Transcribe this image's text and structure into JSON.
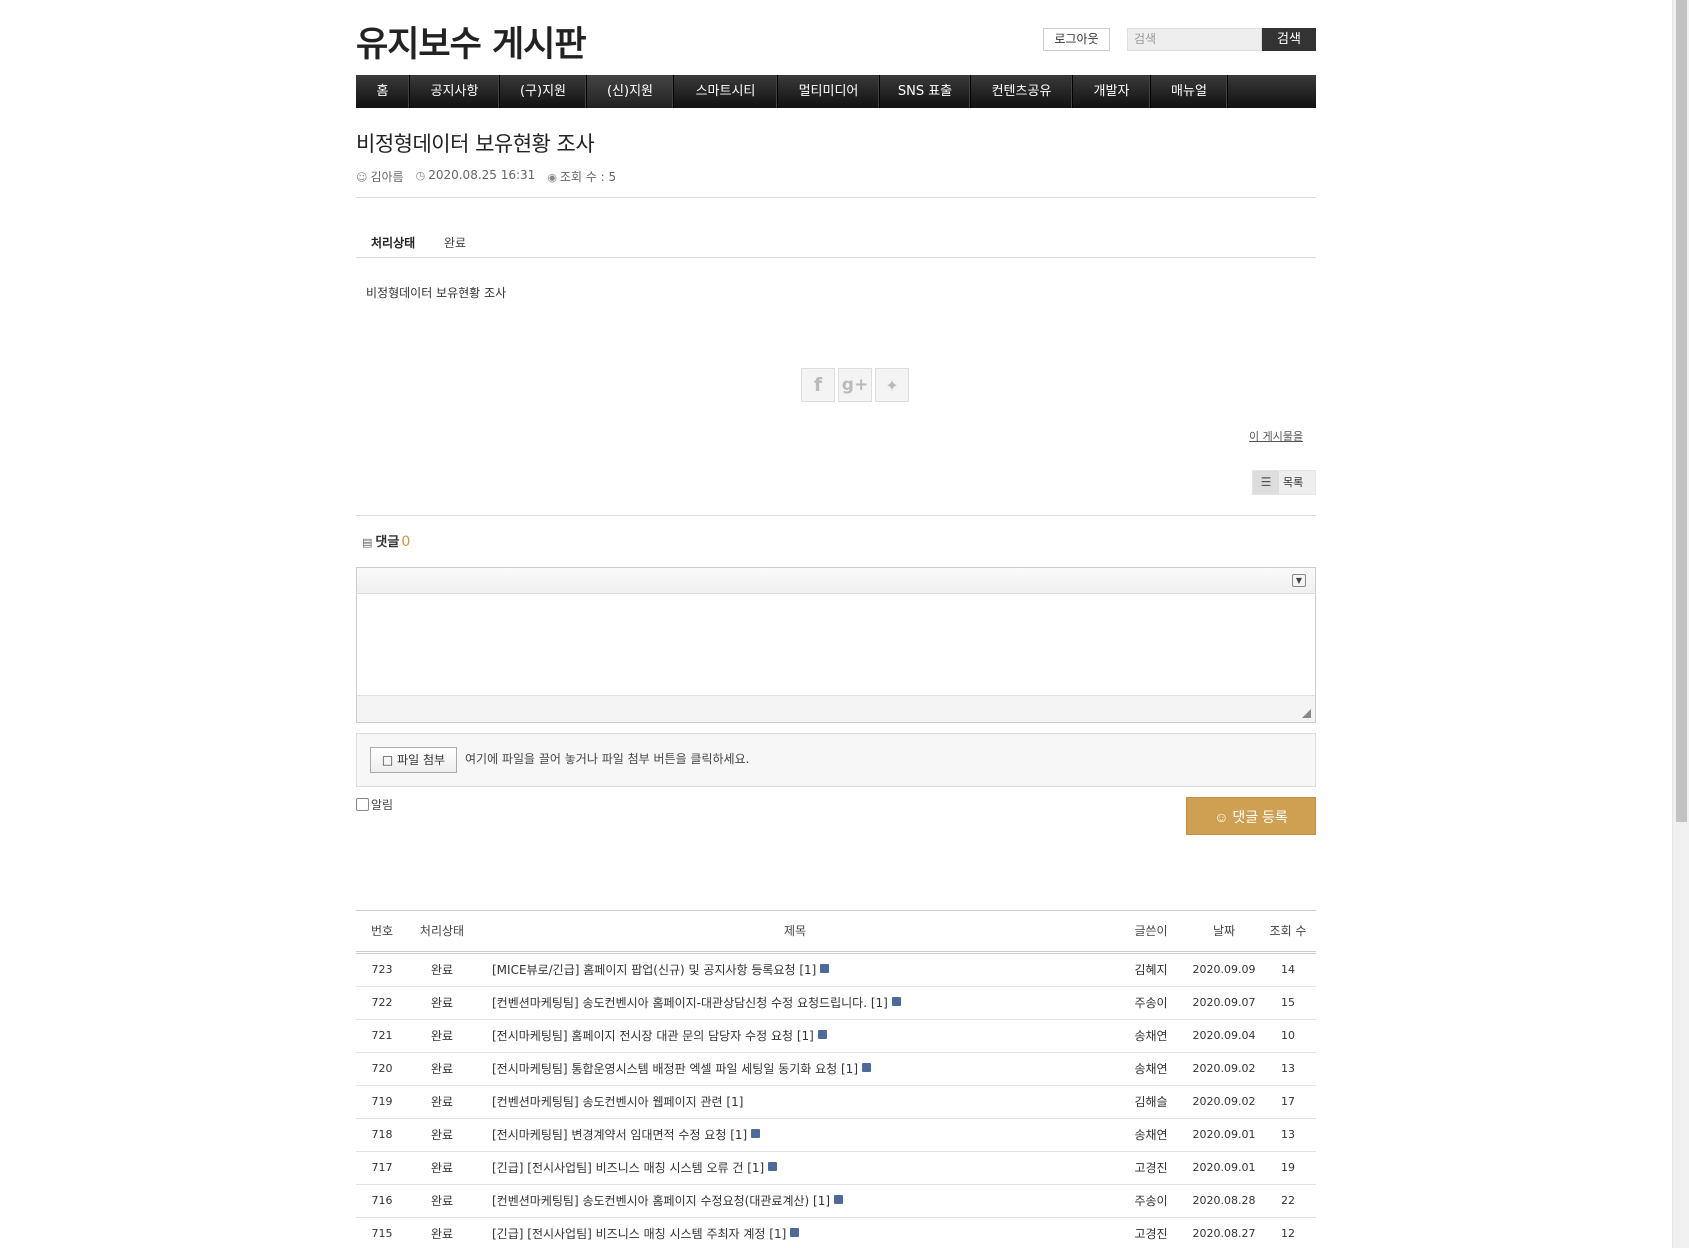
{
  "header": {
    "site_title": "유지보수 게시판",
    "logout_label": "로그아웃",
    "search_placeholder": "검색",
    "search_label": "검색"
  },
  "nav": {
    "items": [
      {
        "label": "홈",
        "active": false
      },
      {
        "label": "공지사항",
        "active": false
      },
      {
        "label": "(구)지원",
        "active": false
      },
      {
        "label": "(신)지원",
        "active": true
      },
      {
        "label": "스마트시티",
        "active": false
      },
      {
        "label": "멀티미디어",
        "active": false
      },
      {
        "label": "SNS 표출",
        "active": false
      },
      {
        "label": "컨텐츠공유",
        "active": false
      },
      {
        "label": "개발자",
        "active": false
      },
      {
        "label": "매뉴얼",
        "active": false
      }
    ]
  },
  "article": {
    "title": "비정형데이터 보유현황 조사",
    "author": "김아름",
    "datetime": "2020.08.25 16:31",
    "views": "조회 수 : 5",
    "status_label": "처리상태",
    "status_value": "완료",
    "body": "비정형데이터 보유현황 조사",
    "share_icons": [
      "facebook-icon",
      "google-plus-icon",
      "twitter-icon"
    ],
    "report_link": "이 게시물을",
    "list_button": "목록"
  },
  "comments": {
    "heading": "댓글",
    "count": "0",
    "upload_button": "파일 첨부",
    "upload_hint": "여기에 파일을 끌어 놓거나 파일 첨부 버튼을 클릭하세요.",
    "notify_label": "알림",
    "submit_label": "댓글 등록",
    "accent_color": "#cfa052"
  },
  "board": {
    "columns": {
      "no": "번호",
      "status": "처리상태",
      "title": "제목",
      "author": "글쓴이",
      "date": "날짜",
      "views": "조회 수"
    },
    "rows": [
      {
        "no": "723",
        "status": "완료",
        "title": "[MICE뷰로/긴급] 홈페이지 팝업(신규) 및 공지사항 등록요청 [1]",
        "file": true,
        "author": "김혜지",
        "date": "2020.09.09",
        "views": "14"
      },
      {
        "no": "722",
        "status": "완료",
        "title": "[컨벤션마케팅팀] 송도컨벤시아 홈페이지-대관상담신청 수정 요청드립니다. [1]",
        "file": true,
        "author": "주송이",
        "date": "2020.09.07",
        "views": "15"
      },
      {
        "no": "721",
        "status": "완료",
        "title": "[전시마케팅팀] 홈페이지 전시장 대관 문의 담당자 수정 요청 [1]",
        "file": true,
        "author": "송채연",
        "date": "2020.09.04",
        "views": "10"
      },
      {
        "no": "720",
        "status": "완료",
        "title": "[전시마케팅팀] 통합운영시스템 배정판 엑셀 파일 세팅일 동기화 요청 [1]",
        "file": true,
        "author": "송채연",
        "date": "2020.09.02",
        "views": "13"
      },
      {
        "no": "719",
        "status": "완료",
        "title": "[컨벤션마케팅팀] 송도컨벤시아 웹페이지 관련 [1]",
        "file": false,
        "author": "김해슬",
        "date": "2020.09.02",
        "views": "17"
      },
      {
        "no": "718",
        "status": "완료",
        "title": "[전시마케팅팀] 변경계약서 임대면적 수정 요청 [1]",
        "file": true,
        "author": "송채연",
        "date": "2020.09.01",
        "views": "13"
      },
      {
        "no": "717",
        "status": "완료",
        "title": "[긴급] [전시사업팀] 비즈니스 매칭 시스템 오류 건 [1]",
        "file": true,
        "author": "고경진",
        "date": "2020.09.01",
        "views": "19"
      },
      {
        "no": "716",
        "status": "완료",
        "title": "[컨벤션마케팅팀] 송도컨벤시아 홈페이지 수정요청(대관료계산) [1]",
        "file": true,
        "author": "주송이",
        "date": "2020.08.28",
        "views": "22"
      },
      {
        "no": "715",
        "status": "완료",
        "title": "[긴급] [전시사업팀] 비즈니스 매칭 시스템 주최자 계정 [1]",
        "file": true,
        "author": "고경진",
        "date": "2020.08.27",
        "views": "12"
      }
    ]
  }
}
